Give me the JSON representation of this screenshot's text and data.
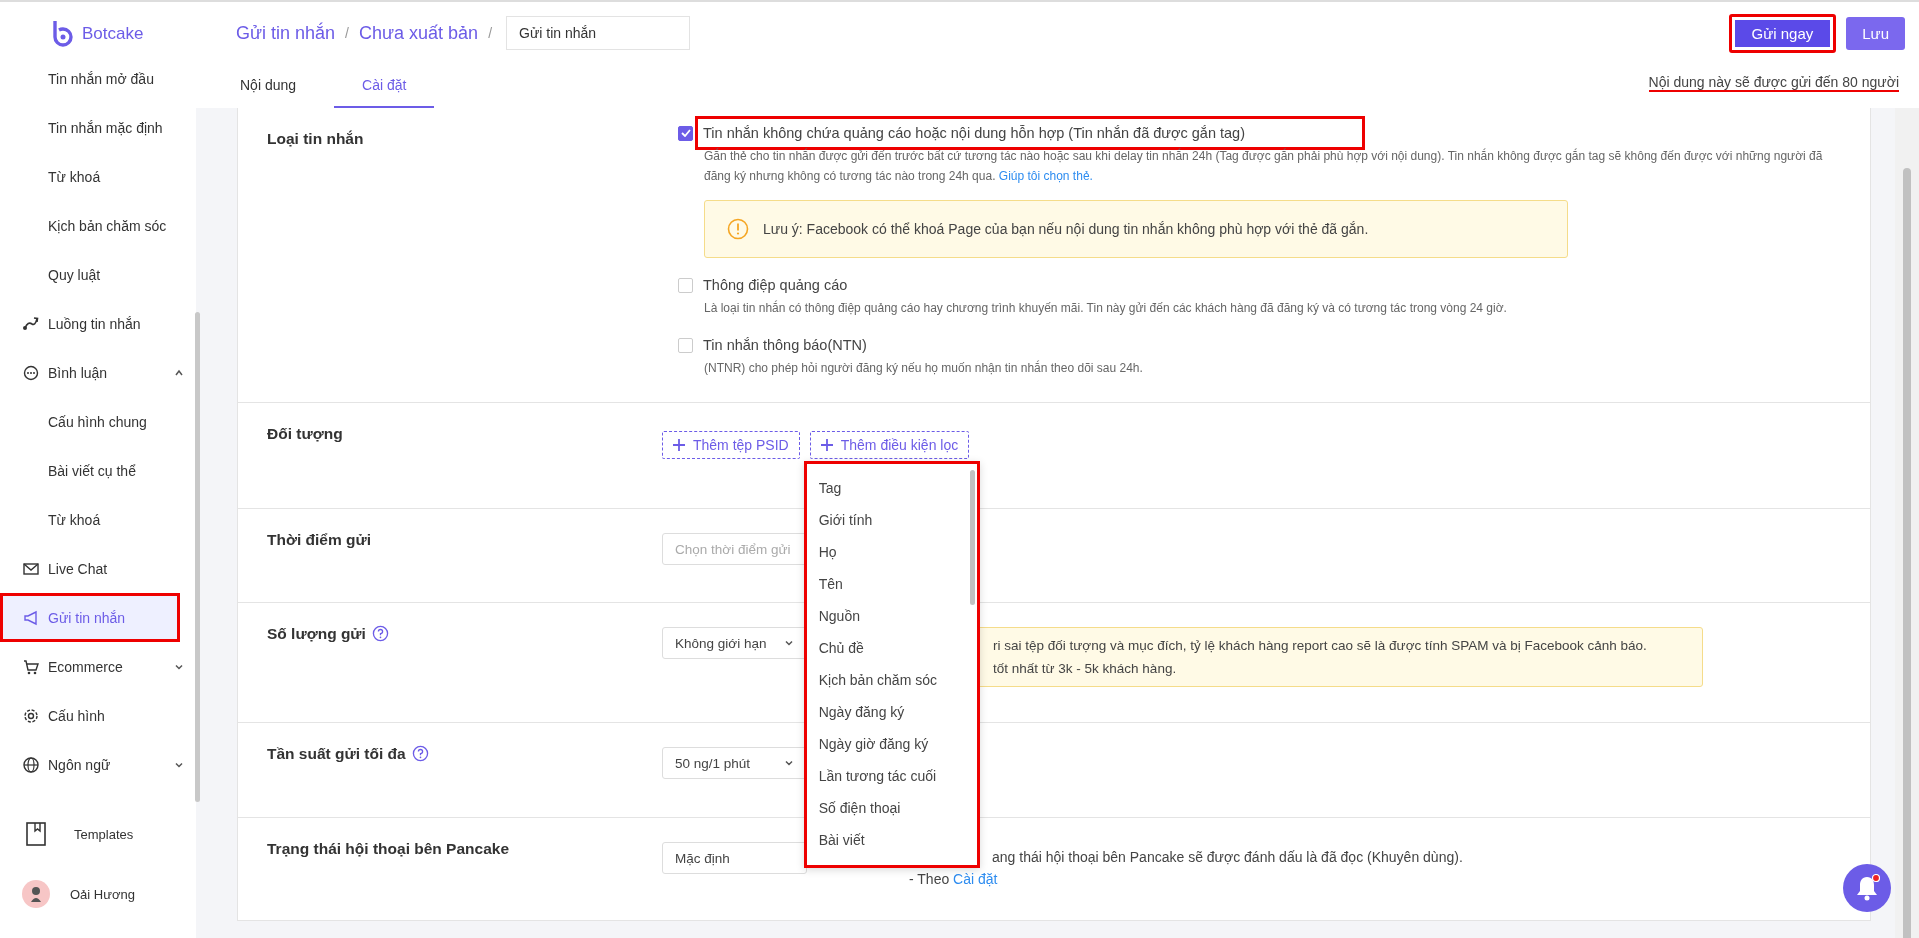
{
  "sidebar": {
    "logo": "Botcake",
    "items": [
      {
        "label": "Tin nhắn mở đầu",
        "kind": "sub",
        "selected": false,
        "highlighted": false
      },
      {
        "label": "Tin nhắn mặc định",
        "kind": "sub",
        "selected": false,
        "highlighted": false
      },
      {
        "label": "Từ khoá",
        "kind": "sub",
        "selected": false,
        "highlighted": false
      },
      {
        "label": "Kịch bản chăm sóc",
        "kind": "sub",
        "selected": false,
        "highlighted": false
      },
      {
        "label": "Quy luật",
        "kind": "sub",
        "selected": false,
        "highlighted": false
      },
      {
        "label": "Luồng tin nhắn",
        "kind": "menu",
        "selected": false,
        "highlighted": false
      },
      {
        "label": "Bình luận",
        "kind": "menu",
        "selected": false,
        "highlighted": false,
        "expanded": true
      },
      {
        "label": "Cấu hình chung",
        "kind": "sub",
        "selected": false,
        "highlighted": false
      },
      {
        "label": "Bài viết cụ thể",
        "kind": "sub",
        "selected": false,
        "highlighted": false
      },
      {
        "label": "Từ khoá",
        "kind": "sub",
        "selected": false,
        "highlighted": false
      },
      {
        "label": "Live Chat",
        "kind": "menu",
        "selected": false,
        "highlighted": false
      },
      {
        "label": "Gửi tin nhắn",
        "kind": "menu",
        "selected": true,
        "highlighted": true
      },
      {
        "label": "Ecommerce",
        "kind": "menu",
        "selected": false,
        "highlighted": false,
        "expanded": false
      },
      {
        "label": "Cấu hình",
        "kind": "menu",
        "selected": false,
        "highlighted": false
      },
      {
        "label": "Ngôn ngữ",
        "kind": "menu",
        "selected": false,
        "highlighted": false,
        "expanded": false
      }
    ],
    "templates": "Templates",
    "user": "Oải Hương"
  },
  "header": {
    "breadcrumb": [
      {
        "kind": "link",
        "text": "Gửi tin nhắn"
      },
      {
        "kind": "sep",
        "text": "/"
      },
      {
        "kind": "link",
        "text": "Chưa xuất bản"
      },
      {
        "kind": "sep",
        "text": "/"
      }
    ],
    "title_field": "Gửi tin nhắn",
    "buttons": [
      {
        "label": "Gửi ngay",
        "kind": "primary",
        "highlighted": true
      },
      {
        "label": "Lưu",
        "kind": "secondary",
        "highlighted": false
      }
    ],
    "tabs": [
      {
        "label": "Nội dung",
        "selected": false
      },
      {
        "label": "Cài đặt",
        "selected": true
      }
    ],
    "audience_note": {
      "text": "Nội dung này sẽ được gửi đến 80 người",
      "underlined": true
    }
  },
  "sections": [
    {
      "kind": "message_type",
      "label": "Loại tin nhắn",
      "options": [
        {
          "label": "Tin nhắn không chứa quảng cáo hoặc nội dung hỗn hợp (Tin nhắn đã được gắn tag)",
          "checked": true,
          "highlighted": true,
          "description": "Gắn thẻ cho tin nhắn được gửi đến trước bất cứ tương tác nào hoặc sau khi delay tin nhắn 24h (Tag được gắn phải phù hợp với nội dung). Tin nhắn không được gắn tag sẽ không đến được với những người đã đăng ký nhưng không có tương tác nào trong 24h qua.",
          "link": "Giúp tôi chọn thẻ.",
          "warning": "Lưu ý: Facebook có thể khoá Page của bạn nếu nội dung tin nhắn không phù hợp với thẻ đã gắn."
        },
        {
          "label": "Thông điệp quảng cáo",
          "checked": false,
          "highlighted": false,
          "description": "Là loại tin nhắn có thông điệp quảng cáo hay chương trình khuyến mãi. Tin này gửi đến các khách hàng đã đăng ký và có tương tác trong vòng 24 giờ."
        },
        {
          "label": "Tin nhắn thông báo(NTN)",
          "checked": false,
          "highlighted": false,
          "description": "(NTNR) cho phép hỏi người đăng ký nếu họ muốn nhận tin nhắn theo dõi sau 24h."
        }
      ]
    },
    {
      "kind": "audience",
      "label": "Đối tượng",
      "buttons": [
        "Thêm tệp PSID",
        "Thêm điều kiện lọc"
      ],
      "menu": {
        "highlighted": true,
        "items": [
          "Tag",
          "Giới tính",
          "Họ",
          "Tên",
          "Nguồn",
          "Chủ đề",
          "Kịch bản chăm sóc",
          "Ngày đăng ký",
          "Ngày giờ đăng ký",
          "Lần tương tác cuối",
          "Số điện thoại",
          "Bài viết"
        ]
      }
    },
    {
      "kind": "date",
      "label": "Thời điểm gửi",
      "placeholder": "Chọn thời điểm gửi"
    },
    {
      "kind": "select",
      "label": "Số lượng gửi",
      "help": true,
      "value": "Không giới hạn",
      "caret": true,
      "warning_lines": [
        "ri sai tệp đối tượng và mục đích, tỷ lệ khách hàng report cao sẽ là được tính SPAM và bị Facebook cảnh báo.",
        "tốt nhất từ 3k - 5k khách hàng."
      ]
    },
    {
      "kind": "select",
      "label": "Tần suất gửi tối đa",
      "help": true,
      "value": "50 ng/1 phút",
      "caret": true
    },
    {
      "kind": "select",
      "label": "Trạng thái hội thoại bên Pancake",
      "value": "Mặc định",
      "notes": [
        {
          "text": "ang thái hội thoại bên Pancake sẽ được đánh dấu là đã đọc (Khuyên dùng)."
        },
        {
          "text": "- Theo",
          "link": "Cài đặt"
        }
      ]
    }
  ]
}
